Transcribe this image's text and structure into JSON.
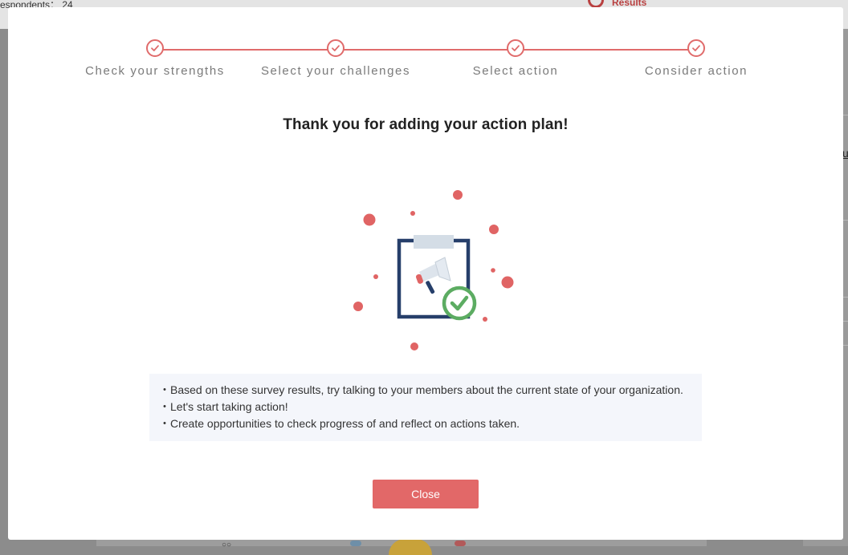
{
  "background": {
    "respondents_text": "espondents： 24",
    "results_label": "Results",
    "right_fragment": "u",
    "bottom_fragment": "○○"
  },
  "stepper": {
    "accent_color": "#e06b6b",
    "steps": [
      {
        "label": "Check your strengths",
        "status": "completed",
        "icon": "check-icon"
      },
      {
        "label": "Select your challenges",
        "status": "completed",
        "icon": "check-icon"
      },
      {
        "label": "Select action",
        "status": "completed",
        "icon": "check-icon"
      },
      {
        "label": "Consider action",
        "status": "completed",
        "icon": "check-icon"
      }
    ]
  },
  "modal": {
    "title": "Thank you for adding your action plan!",
    "illustration_icon": "clipboard-megaphone-check-icon",
    "bullets": [
      "・Based on these survey results, try talking to your members about the current state of your organization.",
      "・Let's start taking action!",
      "・Create opportunities to check progress of and reflect on actions taken."
    ],
    "close_label": "Close",
    "close_color": "#e26868"
  }
}
